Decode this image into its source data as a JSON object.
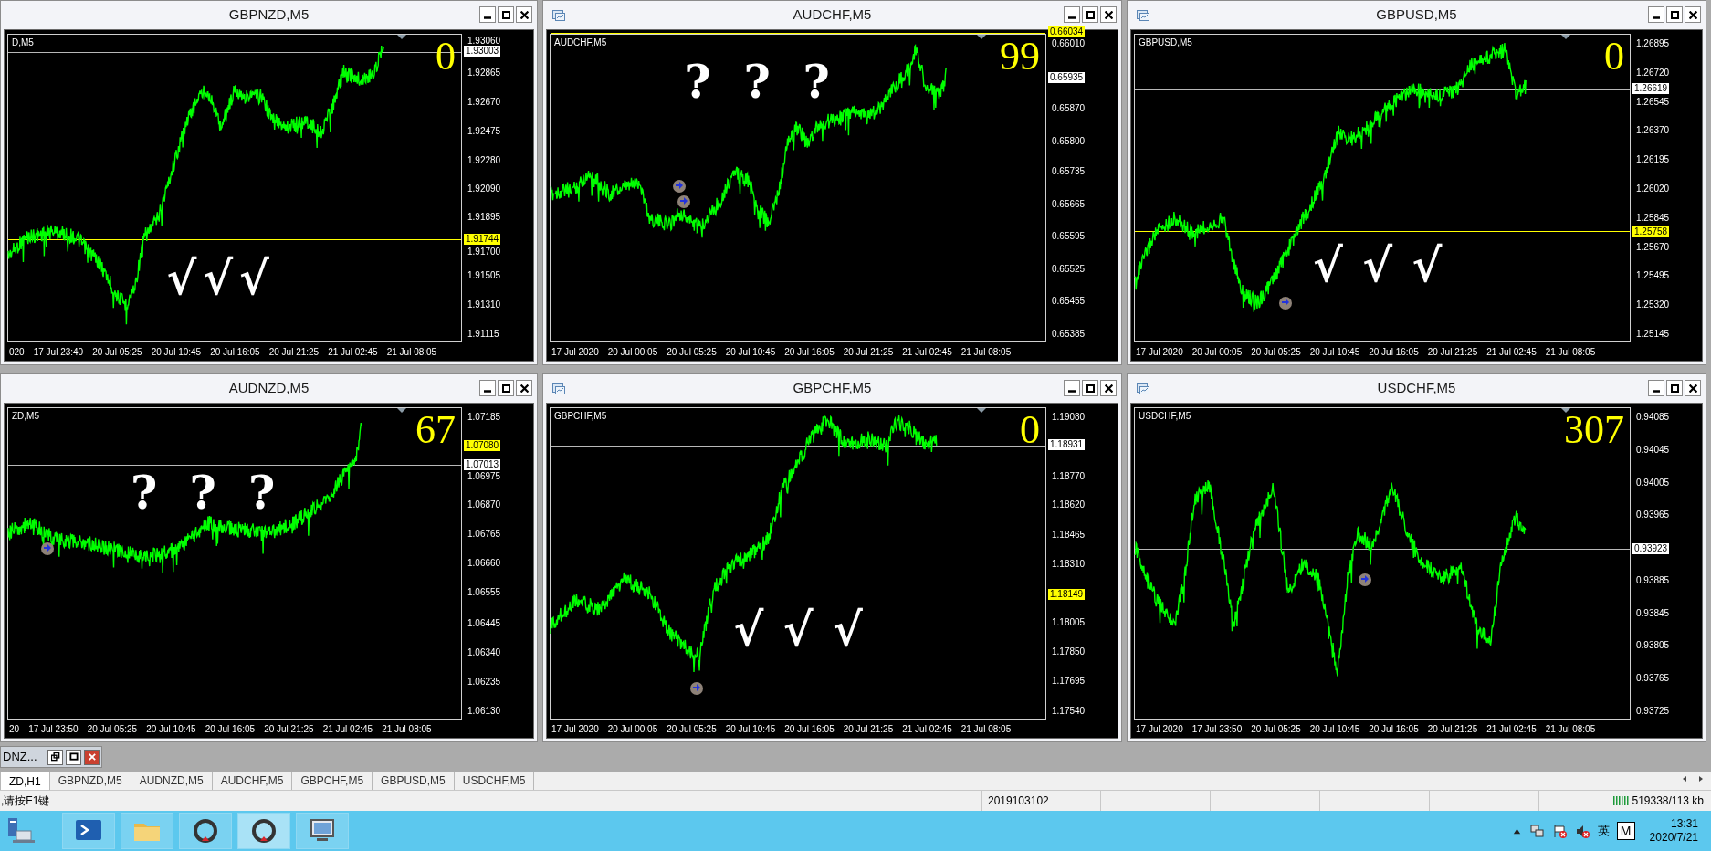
{
  "chart_windows": [
    {
      "title": "GBPNZD,M5",
      "title_icon": false,
      "symbol_label": "D,M5",
      "counter": "0",
      "marks": [
        "√",
        "√",
        "√"
      ],
      "price_labels": [
        "1.93060",
        "1.92865",
        "1.92670",
        "1.92475",
        "1.92280",
        "1.92090",
        "1.91895",
        "1.91700",
        "1.91505",
        "1.91310",
        "1.91115"
      ],
      "price_tags": [
        {
          "value": "1.93003",
          "kind": "bid"
        },
        {
          "value": "1.91744",
          "kind": "level"
        }
      ],
      "time_labels": [
        "020",
        "17 Jul 23:40",
        "20 Jul 05:25",
        "20 Jul 10:45",
        "20 Jul 16:05",
        "20 Jul 21:25",
        "21 Jul 02:45",
        "21 Jul 08:05"
      ]
    },
    {
      "title": "AUDCHF,M5",
      "title_icon": true,
      "symbol_label": "AUDCHF,M5",
      "counter": "99",
      "marks": [
        "?",
        "?",
        "?"
      ],
      "price_labels": [
        "0.66010",
        "0.65870",
        "0.65800",
        "0.65735",
        "0.65665",
        "0.65595",
        "0.65525",
        "0.65455",
        "0.65385"
      ],
      "price_tags": [
        {
          "value": "0.66034",
          "kind": "level"
        },
        {
          "value": "0.65935",
          "kind": "bid"
        }
      ],
      "time_labels": [
        "17 Jul 2020",
        "20 Jul 00:05",
        "20 Jul 05:25",
        "20 Jul 10:45",
        "20 Jul 16:05",
        "20 Jul 21:25",
        "21 Jul 02:45",
        "21 Jul 08:05"
      ]
    },
    {
      "title": "GBPUSD,M5",
      "title_icon": true,
      "symbol_label": "GBPUSD,M5",
      "counter": "0",
      "marks": [
        "√",
        "√",
        "√"
      ],
      "price_labels": [
        "1.26895",
        "1.26720",
        "1.26545",
        "1.26370",
        "1.26195",
        "1.26020",
        "1.25845",
        "1.25670",
        "1.25495",
        "1.25320",
        "1.25145"
      ],
      "price_tags": [
        {
          "value": "1.26619",
          "kind": "bid"
        },
        {
          "value": "1.25758",
          "kind": "level"
        }
      ],
      "time_labels": [
        "17 Jul 2020",
        "20 Jul 00:05",
        "20 Jul 05:25",
        "20 Jul 10:45",
        "20 Jul 16:05",
        "20 Jul 21:25",
        "21 Jul 02:45",
        "21 Jul 08:05"
      ]
    },
    {
      "title": "AUDNZD,M5",
      "title_icon": false,
      "symbol_label": "ZD,M5",
      "counter": "67",
      "marks": [
        "?",
        "?",
        "?"
      ],
      "price_labels": [
        "1.07185",
        "1.06975",
        "1.06870",
        "1.06765",
        "1.06660",
        "1.06555",
        "1.06445",
        "1.06340",
        "1.06235",
        "1.06130"
      ],
      "price_tags": [
        {
          "value": "1.07080",
          "kind": "level"
        },
        {
          "value": "1.07013",
          "kind": "bid"
        }
      ],
      "time_labels": [
        "20",
        "17 Jul 23:50",
        "20 Jul 05:25",
        "20 Jul 10:45",
        "20 Jul 16:05",
        "20 Jul 21:25",
        "21 Jul 02:45",
        "21 Jul 08:05"
      ]
    },
    {
      "title": "GBPCHF,M5",
      "title_icon": true,
      "symbol_label": "GBPCHF,M5",
      "counter": "0",
      "marks": [
        "√",
        "√",
        "√"
      ],
      "price_labels": [
        "1.19080",
        "1.18770",
        "1.18620",
        "1.18465",
        "1.18310",
        "1.18005",
        "1.17850",
        "1.17695",
        "1.17540"
      ],
      "price_tags": [
        {
          "value": "1.18931",
          "kind": "bid"
        },
        {
          "value": "1.18149",
          "kind": "level"
        }
      ],
      "time_labels": [
        "17 Jul 2020",
        "20 Jul 00:05",
        "20 Jul 05:25",
        "20 Jul 10:45",
        "20 Jul 16:05",
        "20 Jul 21:25",
        "21 Jul 02:45",
        "21 Jul 08:05"
      ]
    },
    {
      "title": "USDCHF,M5",
      "title_icon": true,
      "symbol_label": "USDCHF,M5",
      "counter": "307",
      "price_labels": [
        "0.94085",
        "0.94045",
        "0.94005",
        "0.93965",
        "0.93885",
        "0.93845",
        "0.93805",
        "0.93765",
        "0.93725"
      ],
      "price_tags": [
        {
          "value": "0.93923",
          "kind": "bid"
        }
      ],
      "time_labels": [
        "17 Jul 2020",
        "17 Jul 23:50",
        "20 Jul 05:25",
        "20 Jul 10:45",
        "20 Jul 16:05",
        "20 Jul 21:25",
        "21 Jul 02:45",
        "21 Jul 08:05"
      ]
    }
  ],
  "minimized_window": {
    "title": "DNZ..."
  },
  "tabs": [
    {
      "label": "ZD,H1",
      "selected": true
    },
    {
      "label": "GBPNZD,M5",
      "selected": false
    },
    {
      "label": "AUDNZD,M5",
      "selected": false
    },
    {
      "label": "AUDCHF,M5",
      "selected": false
    },
    {
      "label": "GBPCHF,M5",
      "selected": false
    },
    {
      "label": "GBPUSD,M5",
      "selected": false
    },
    {
      "label": "USDCHF,M5",
      "selected": false
    }
  ],
  "status_bar": {
    "hint": ",请按F1键",
    "segment": "2019103102",
    "memory": "519338/113 kb"
  },
  "taskbar": {
    "apps": [
      {
        "kind": "terminal",
        "selected": false
      },
      {
        "kind": "folder",
        "selected": false
      },
      {
        "kind": "ring",
        "selected": false
      },
      {
        "kind": "ring",
        "selected": true
      },
      {
        "kind": "monitor",
        "selected": false
      }
    ],
    "language": "英",
    "ime": "M",
    "time": "13:31",
    "date": "2020/7/21"
  }
}
